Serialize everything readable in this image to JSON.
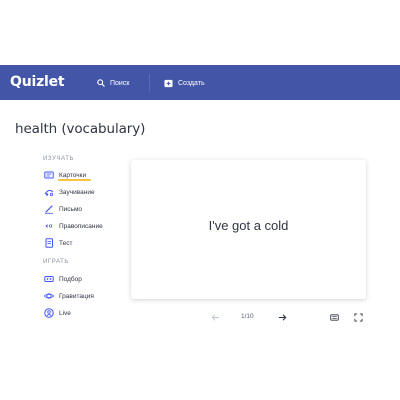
{
  "header": {
    "logo": "Quizlet",
    "search_label": "Поиск",
    "create_label": "Создать"
  },
  "page": {
    "title": "health (vocabulary)"
  },
  "sidebar": {
    "study_heading": "ИЗУЧАТЬ",
    "study_items": [
      {
        "label": "Карточки",
        "icon": "cards-icon",
        "active": true
      },
      {
        "label": "Заучивание",
        "icon": "learn-icon"
      },
      {
        "label": "Письмо",
        "icon": "write-icon"
      },
      {
        "label": "Правописание",
        "icon": "spell-icon"
      },
      {
        "label": "Тест",
        "icon": "test-icon"
      }
    ],
    "play_heading": "ИГРАТЬ",
    "play_items": [
      {
        "label": "Подбор",
        "icon": "match-icon"
      },
      {
        "label": "Гравитация",
        "icon": "gravity-icon"
      },
      {
        "label": "Live",
        "icon": "live-icon"
      }
    ]
  },
  "flashcard": {
    "term": "I've got a cold"
  },
  "controls": {
    "counter": "1/10"
  },
  "colors": {
    "topbar": "#4255a6",
    "active_underline": "#f6c444",
    "icon_blue": "#4255ff"
  }
}
